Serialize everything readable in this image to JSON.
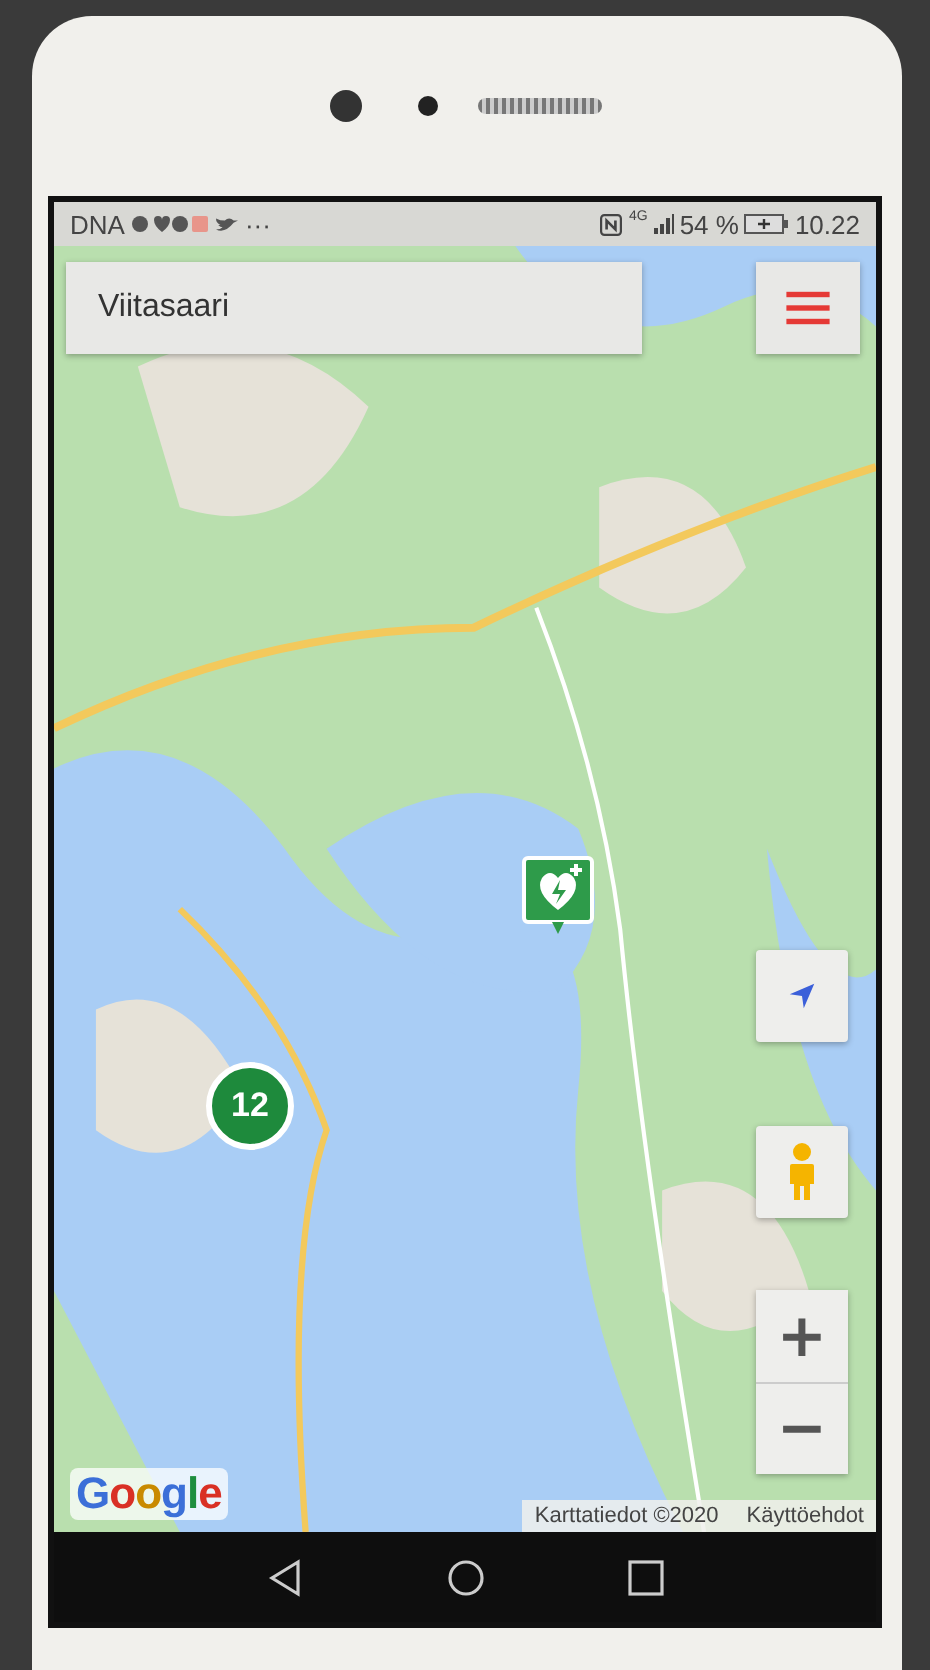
{
  "status_bar": {
    "carrier": "DNA",
    "more": "···",
    "network": "4G",
    "battery": "54 %",
    "time": "10.22"
  },
  "search": {
    "value": "Viitasaari"
  },
  "map": {
    "cluster": {
      "count": "12"
    },
    "logo": "Google",
    "attribution": "Karttatiedot ©2020",
    "terms": "Käyttöehdot"
  },
  "zoom": {
    "plus": "+",
    "minus": "−"
  }
}
